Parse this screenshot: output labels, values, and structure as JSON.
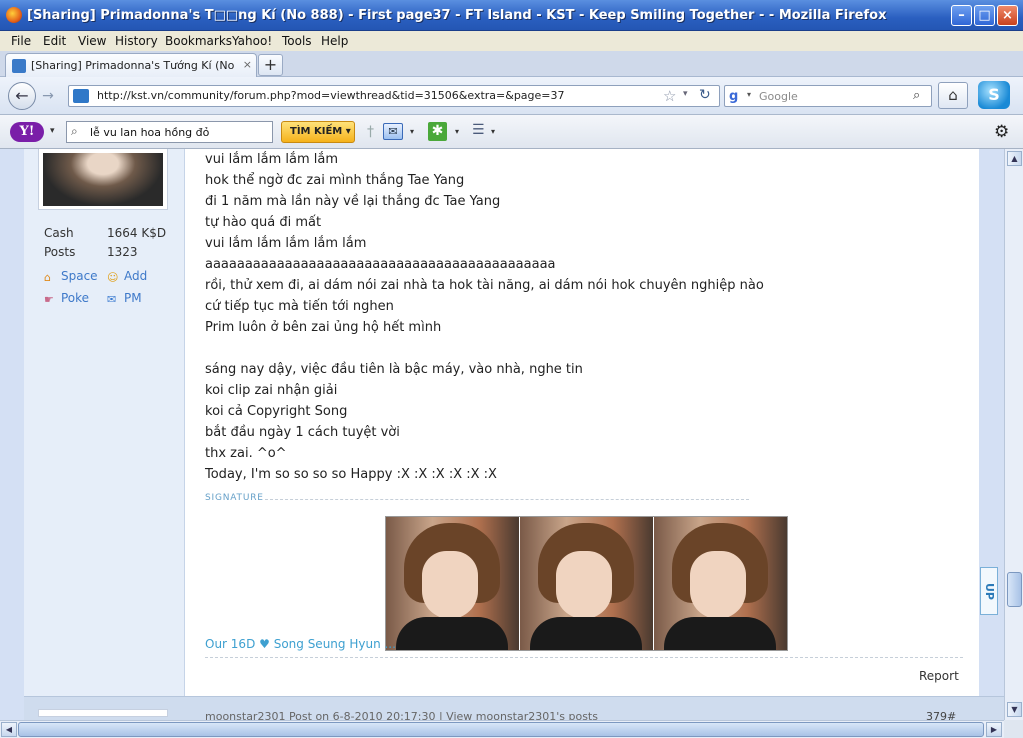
{
  "window": {
    "title": "[Sharing] Primadonna's T□□ng Kí (No 888) - First page37 - FT Island - KST - Keep Smiling Together - - Mozilla Firefox",
    "min": "–",
    "max": "□",
    "close": "×"
  },
  "menu": [
    "File",
    "Edit",
    "View",
    "History",
    "Bookmarks",
    "Yahoo!",
    "Tools",
    "Help"
  ],
  "tab": {
    "title": "[Sharing] Primadonna's Tướng Kí (No 888) - ...",
    "close": "×",
    "new": "+"
  },
  "nav": {
    "back": "←",
    "forward": "→",
    "url": "http://kst.vn/community/forum.php?mod=viewthread&tid=31506&extra=&page=37",
    "star": "☆",
    "reload": "↻",
    "search_placeholder": "Google",
    "search_engine_icon": "g",
    "magnifier": "⌕",
    "home": "⌂",
    "skype": "S"
  },
  "yahoo_toolbar": {
    "logo": "Y!",
    "search_icon": "⌕",
    "query": "lễ vu lan hoa hồng đỏ",
    "button": "TÌM KIẾM",
    "button_arrow": "▾",
    "divider": "†",
    "mail_icon": "✉",
    "apps_icon": "✱",
    "bookmarks_icon": "☰",
    "drop": "▾",
    "settings_icon": "⚙"
  },
  "profile": {
    "stats": [
      {
        "label": "Cash",
        "value": "1664 K$D"
      },
      {
        "label": "Posts",
        "value": "1323"
      }
    ],
    "links": [
      {
        "icon": "⌂",
        "label": "Space"
      },
      {
        "icon": "☺",
        "label": "Add"
      },
      {
        "icon": "☛",
        "label": "Poke"
      },
      {
        "icon": "✉",
        "label": "PM"
      }
    ]
  },
  "post": {
    "lines": [
      "vui lắm lắm lắm lắm",
      "hok thể ngờ đc zai mình thắng Tae Yang",
      "đi 1 năm mà lần này về lại thắng đc Tae Yang",
      "tự hào quá đi mất",
      "vui lắm lắm lắm lắm lắm",
      "aaaaaaaaaaaaaaaaaaaaaaaaaaaaaaaaaaaaaaaaaaaa",
      "rồi, thử xem đi, ai dám nói zai nhà ta hok tài năng, ai dám nói hok chuyên nghiệp nào",
      "cứ tiếp tục mà tiến tới nghen",
      "Prim luôn ở bên zai ủng hộ hết mình",
      "",
      "sáng nay dậy, việc đầu tiên là bậc máy, vào nhà, nghe tin",
      "koi clip zai nhận giải",
      "koi cả Copyright Song",
      "bắt đầu ngày 1 cách tuyệt vời",
      "thx zai. ^o^",
      "Today, I'm so so so so Happy :X :X :X :X :X :X"
    ],
    "signature_label": "SIGNATURE",
    "signature_caption": "Our 16D ♥ Song Seung Hyun ...",
    "report": "Report",
    "up_button": "UP"
  },
  "next_post": {
    "header": "moonstar2301 Post on 6-8-2010 20:17:30 | View moonstar2301's posts",
    "floor": "379#"
  },
  "scroll": {
    "up": "▲",
    "down": "▼",
    "left": "◀",
    "right": "▶"
  }
}
